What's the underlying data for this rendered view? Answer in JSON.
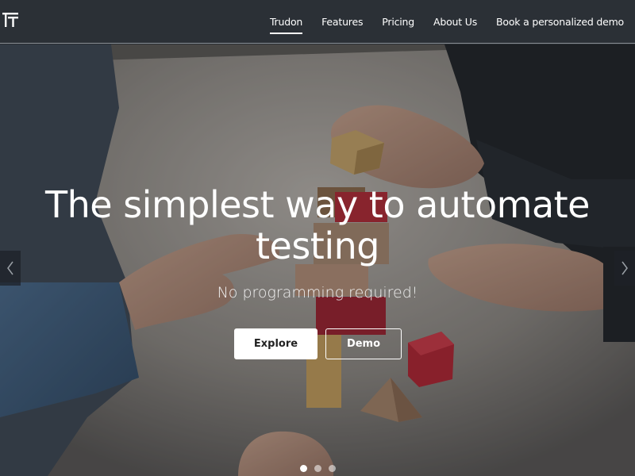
{
  "brand": {
    "logo_icon": "trudon-logo-icon"
  },
  "nav": {
    "items": [
      {
        "label": "Trudon",
        "active": true
      },
      {
        "label": "Features",
        "active": false
      },
      {
        "label": "Pricing",
        "active": false
      },
      {
        "label": "About Us",
        "active": false
      },
      {
        "label": "Book a personalized demo",
        "active": false
      }
    ]
  },
  "hero": {
    "title_line1": "The simplest way to automate",
    "title_line2": "testing",
    "subtitle": "No programming required!",
    "explore_label": "Explore",
    "demo_label": "Demo",
    "background_image": "wooden-blocks-hands-photo"
  },
  "carousel": {
    "prev_icon": "chevron-left-icon",
    "next_icon": "chevron-right-icon",
    "slides_total": 3,
    "active_slide": 1
  },
  "colors": {
    "navbar_bg": "#2b3036",
    "accent_white": "#ffffff"
  }
}
